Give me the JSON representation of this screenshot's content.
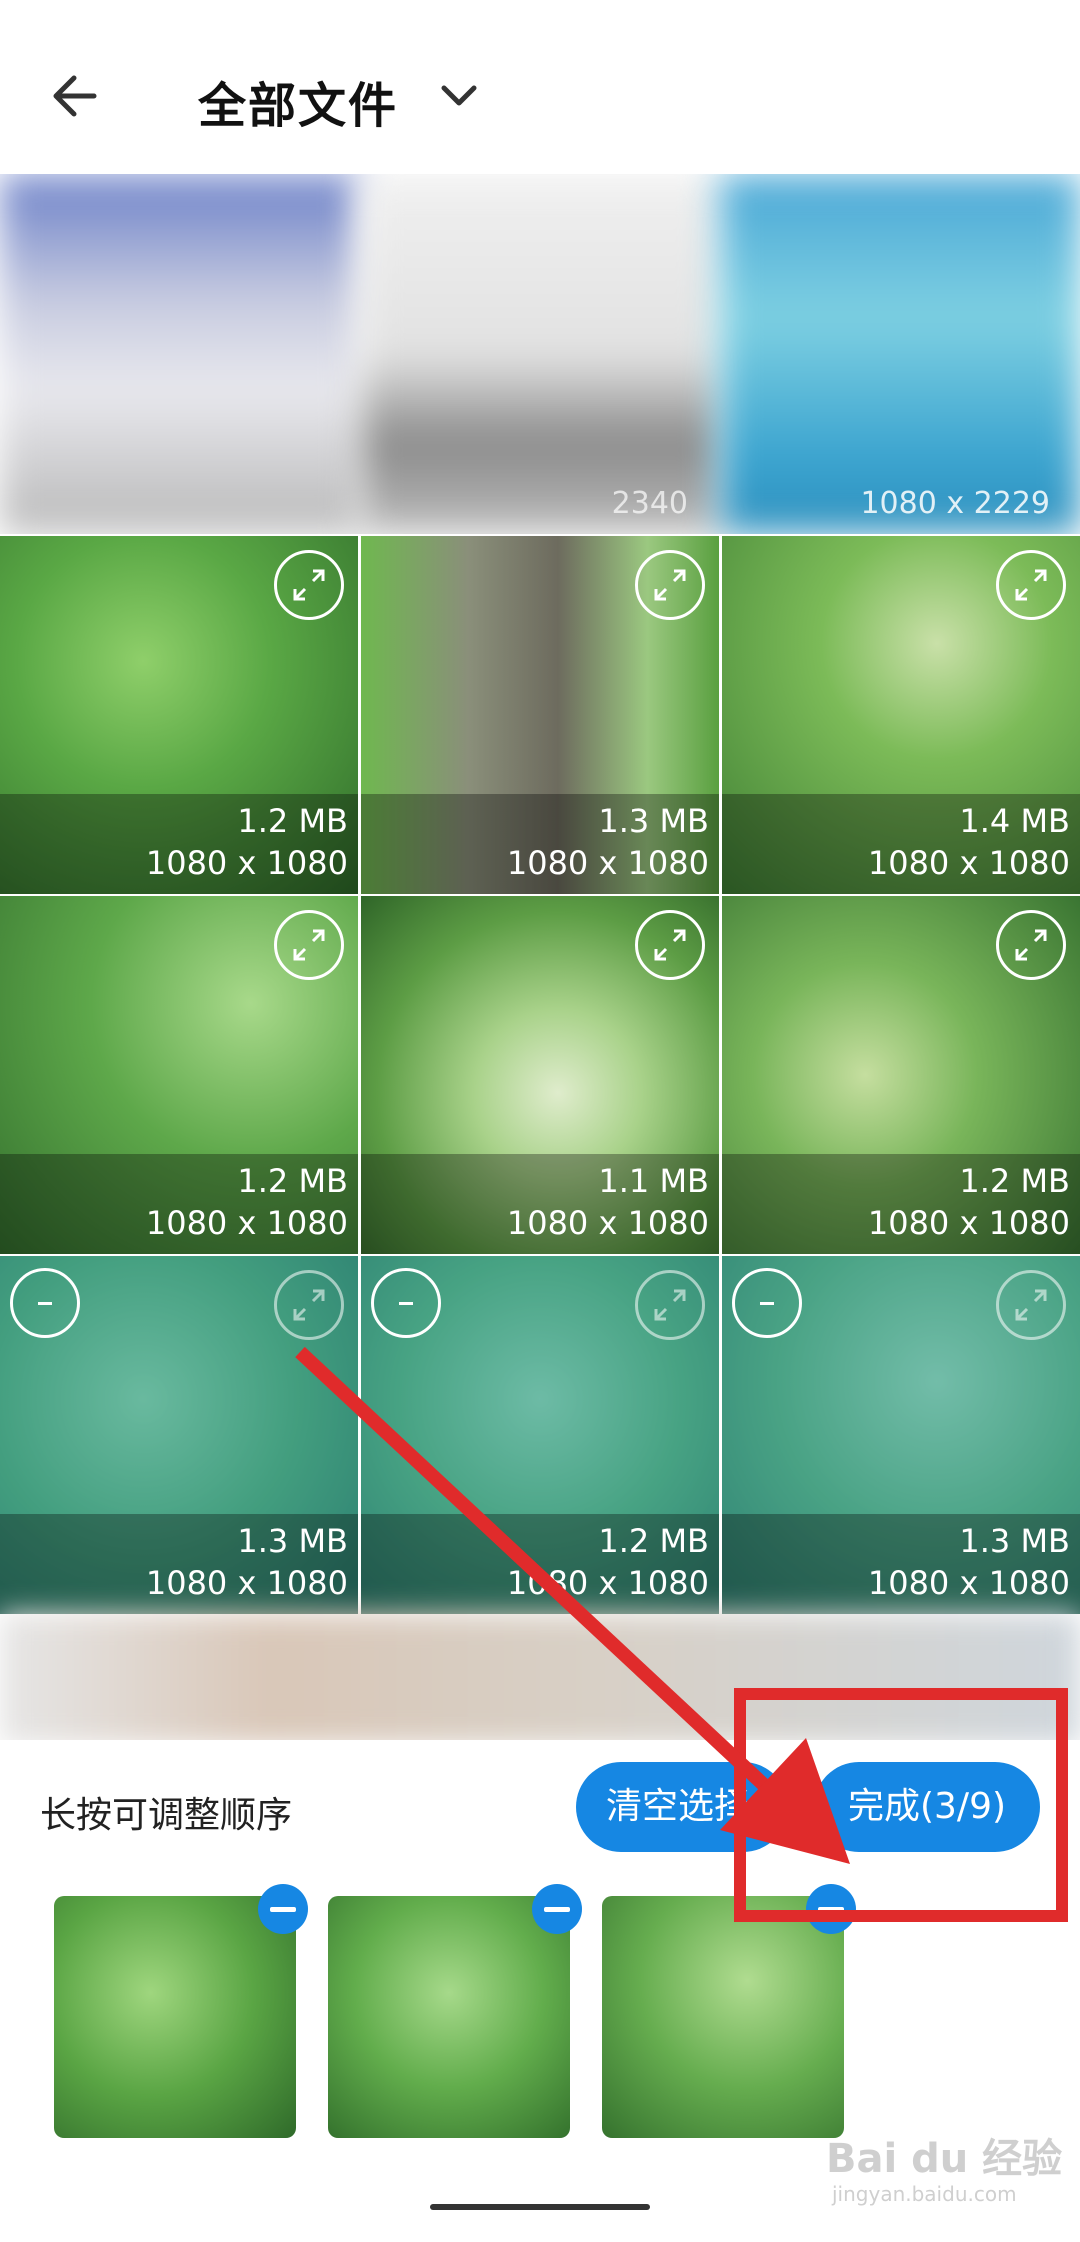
{
  "header": {
    "title": "全部文件",
    "back_icon": "arrow-left-icon",
    "dropdown_icon": "chevron-down-icon"
  },
  "grid": {
    "top_row_partial_captions": [
      "2340",
      "1080 x 2229"
    ],
    "tiles": [
      {
        "size": "1.2 MB",
        "dim": "1080 x 1080",
        "selected": false
      },
      {
        "size": "1.3 MB",
        "dim": "1080 x 1080",
        "selected": false
      },
      {
        "size": "1.4 MB",
        "dim": "1080 x 1080",
        "selected": false
      },
      {
        "size": "1.2 MB",
        "dim": "1080 x 1080",
        "selected": false
      },
      {
        "size": "1.1 MB",
        "dim": "1080 x 1080",
        "selected": false
      },
      {
        "size": "1.2 MB",
        "dim": "1080 x 1080",
        "selected": false
      },
      {
        "size": "1.3 MB",
        "dim": "1080 x 1080",
        "selected": true
      },
      {
        "size": "1.2 MB",
        "dim": "1080 x 1080",
        "selected": true
      },
      {
        "size": "1.3 MB",
        "dim": "1080 x 1080",
        "selected": true
      }
    ]
  },
  "tray": {
    "hint": "长按可调整顺序",
    "clear_label": "清空选择",
    "done_label": "完成(3/9)"
  },
  "colors": {
    "accent": "#1687e3",
    "annotation_red": "#e02b2b"
  },
  "watermark": {
    "text": "Bai du 经验",
    "sub": "jingyan.baidu.com"
  }
}
